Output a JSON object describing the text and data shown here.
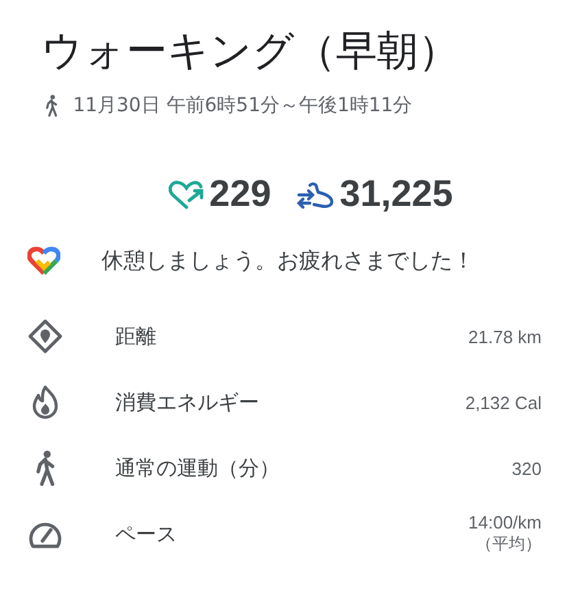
{
  "title": "ウォーキング（早朝）",
  "subtitle": "11月30日 午前6時51分～午後1時11分",
  "stats": [
    {
      "kind": "heart",
      "value": "229"
    },
    {
      "kind": "steps",
      "value": "31,225"
    }
  ],
  "message": "休憩しましょう。お疲れさまでした！",
  "metrics": [
    {
      "kind": "distance",
      "label": "距離",
      "value": "21.78 km"
    },
    {
      "kind": "energy",
      "label": "消費エネルギー",
      "value": "2,132 Cal"
    },
    {
      "kind": "walk",
      "label": "通常の運動（分）",
      "value": "320"
    },
    {
      "kind": "pace",
      "label": "ペース",
      "value": "14:00/km",
      "note": "（平均）"
    }
  ]
}
